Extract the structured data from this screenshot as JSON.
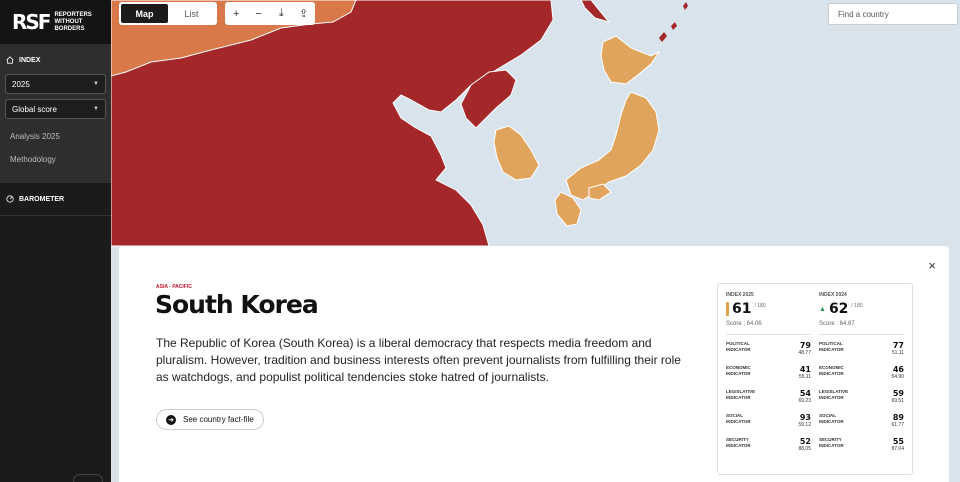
{
  "brand": {
    "mark": "RSF",
    "line1": "REPORTERS",
    "line2": "WITHOUT BORDERS"
  },
  "sidebar": {
    "index_label": "INDEX",
    "year_select": "2025",
    "score_select": "Global score",
    "links": [
      "Analysis 2025",
      "Methodology"
    ],
    "barometer_label": "BAROMETER"
  },
  "toolbar": {
    "view_map": "Map",
    "view_list": "List",
    "zoom_in": "+",
    "zoom_out": "−",
    "download": "⤓",
    "share": "⇪"
  },
  "search": {
    "placeholder": "Find a country"
  },
  "card": {
    "region": "ASIA - PACIFIC",
    "country": "South Korea",
    "description": "The Republic of Korea (South Korea) is a liberal democracy that respects media freedom and pluralism. However, tradition and business interests often prevent journalists from fulfilling their role as watchdogs, and populist political tendencies stoke hatred of journalists.",
    "factfile_label": "See country fact-file",
    "close": "×"
  },
  "stats": {
    "col2025": {
      "label": "INDEX 2025",
      "rank": "61",
      "of": "/ 180",
      "score": "Score : 64.06",
      "bar_color": "#e0a04a"
    },
    "col2024": {
      "label": "INDEX 2024",
      "rank": "62",
      "of": "/ 180",
      "score": "Score : 64.87",
      "trend": "▲"
    },
    "indicators2025": [
      {
        "line1": "POLITICAL",
        "line2": "INDICATOR",
        "rank": "79",
        "score": "48.77"
      },
      {
        "line1": "ECONOMIC",
        "line2": "INDICATOR",
        "rank": "41",
        "score": "55.11"
      },
      {
        "line1": "LEGISLATIVE",
        "line2": "INDICATOR",
        "rank": "54",
        "score": "69.23"
      },
      {
        "line1": "SOCIAL",
        "line2": "INDICATOR",
        "rank": "93",
        "score": "59.12"
      },
      {
        "line1": "SECURITY",
        "line2": "INDICATOR",
        "rank": "52",
        "score": "88.05"
      }
    ],
    "indicators2024": [
      {
        "line1": "POLITICAL",
        "line2": "INDICATOR",
        "rank": "77",
        "score": "51.11"
      },
      {
        "line1": "ECONOMIC",
        "line2": "INDICATOR",
        "rank": "46",
        "score": "54.90"
      },
      {
        "line1": "LEGISLATIVE",
        "line2": "INDICATOR",
        "rank": "59",
        "score": "69.51"
      },
      {
        "line1": "SOCIAL",
        "line2": "INDICATOR",
        "rank": "89",
        "score": "61.77"
      },
      {
        "line1": "SECURITY",
        "line2": "INDICATOR",
        "rank": "55",
        "score": "87.04"
      }
    ]
  },
  "colors": {
    "very_serious": "#a4282a",
    "difficult": "#d97848",
    "problematic": "#e0a45c",
    "sea": "#d8e3ec"
  }
}
